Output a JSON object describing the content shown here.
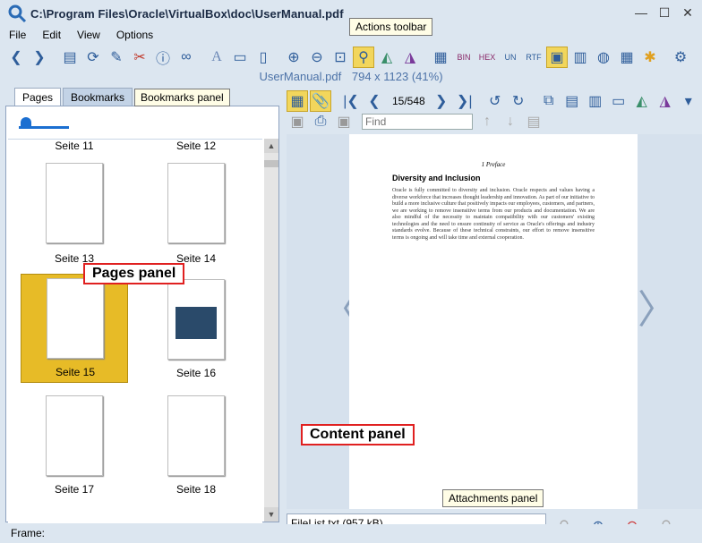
{
  "window": {
    "title": "C:\\Program Files\\Oracle\\VirtualBox\\doc\\UserManual.pdf",
    "minimize_glyph": "—",
    "maximize_glyph": "☐",
    "close_glyph": "✕"
  },
  "menu": [
    "File",
    "Edit",
    "View",
    "Options"
  ],
  "toolbar": {
    "icons": [
      "back-icon",
      "forward-icon",
      "select-icon",
      "refresh-icon",
      "pen-icon",
      "cut-icon",
      "info-icon",
      "binoculars-icon",
      "font-icon",
      "page-icon",
      "page-alt-icon",
      "zoom-in-icon",
      "zoom-out-icon",
      "zoom-fit-icon",
      "zoom-area-icon",
      "flip-icon",
      "flip-alt-icon",
      "doc-icon",
      "bin-icon",
      "hex-icon",
      "unicode-icon",
      "rtf-icon",
      "image-icon",
      "grid-icon",
      "globe-icon",
      "table-icon",
      "puzzle-icon",
      "gear-icon"
    ]
  },
  "document": {
    "filename": "UserManual.pdf",
    "dimensions": "794 x 1123 (41%)"
  },
  "left_panel": {
    "tabs": [
      "Pages",
      "Bookmarks"
    ],
    "thumbnails": [
      {
        "label": "Seite 11"
      },
      {
        "label": "Seite 12"
      },
      {
        "label": "Seite 13"
      },
      {
        "label": "Seite 14"
      },
      {
        "label": "Seite 15",
        "selected": true
      },
      {
        "label": "Seite 16"
      },
      {
        "label": "Seite 17"
      },
      {
        "label": "Seite 18"
      }
    ]
  },
  "status": {
    "label": "Frame:"
  },
  "right_panel": {
    "page_indicator": "15/548",
    "find_placeholder": "Find",
    "page_header": "1 Preface",
    "page_heading": "Diversity and Inclusion",
    "page_body": "Oracle is fully committed to diversity and inclusion. Oracle respects and values having a diverse workforce that increases thought leadership and innovation. As part of our initiative to build a more inclusive culture that positively impacts our employees, customers, and partners, we are working to remove insensitive terms from our products and documentation. We are also mindful of the necessity to maintain compatibility with our customers' existing technologies and the need to ensure continuity of service as Oracle's offerings and industry standards evolve. Because of these technical constraints, our effort to remove insensitive terms is ongoing and will take time and external cooperation.",
    "attachment": "FileList.txt (957 kB)",
    "prev_glyph": "〈",
    "next_glyph": "〉"
  },
  "callouts": {
    "actions_toolbar": "Actions toolbar",
    "bookmarks_panel": "Bookmarks panel",
    "pages_panel": "Pages panel",
    "content_panel": "Content panel",
    "attachments_panel": "Attachments panel"
  },
  "colors": {
    "selected_thumb": "#e7bb27",
    "accent_blue": "#1b6fd1",
    "callout_red": "#e02020"
  }
}
